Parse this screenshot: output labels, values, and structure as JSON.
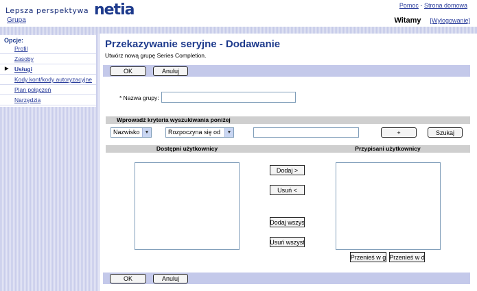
{
  "header": {
    "tagline": "Lepsza perspektywa",
    "logo": "netia",
    "group_link": "Grupa",
    "links": {
      "help": "Pomoc",
      "separator": "-",
      "home": "Strona domowa"
    },
    "welcome": "Witamy",
    "logout": "[Wylogowanie]"
  },
  "sidebar": {
    "title": "Opcje:",
    "items": [
      {
        "label": "Profil",
        "active": false
      },
      {
        "label": "Zasoby",
        "active": false
      },
      {
        "label": "Usługi",
        "active": true
      },
      {
        "label": "Kody kont/kody autoryzacyjne",
        "active": false
      },
      {
        "label": "Plan połączeń",
        "active": false
      },
      {
        "label": "Narzędzia",
        "active": false
      }
    ]
  },
  "main": {
    "title": "Przekazywanie seryjne - Dodawanie",
    "subtitle": "Utwórz nową grupę Series Completion.",
    "ok_label": "OK",
    "cancel_label": "Anuluj",
    "group_name_label": "* Nazwa grupy:",
    "group_name_value": "",
    "search_section": "Wprowadź kryteria wyszukiwania poniżej",
    "search_field_select": "Nazwisko",
    "search_mode_select": "Rozpoczyna się od",
    "search_value": "",
    "plus_label": "+",
    "search_button": "Szukaj",
    "available_header": "Dostępni użytkownicy",
    "assigned_header": "Przypisani użytkownicy",
    "add_button": "Dodaj >",
    "remove_button": "Usuń <",
    "add_all_button": "Dodaj wszys",
    "remove_all_button": "Usuń wszyst",
    "move_up_button": "Przenieś w g",
    "move_down_button": "Przenieś w d"
  }
}
